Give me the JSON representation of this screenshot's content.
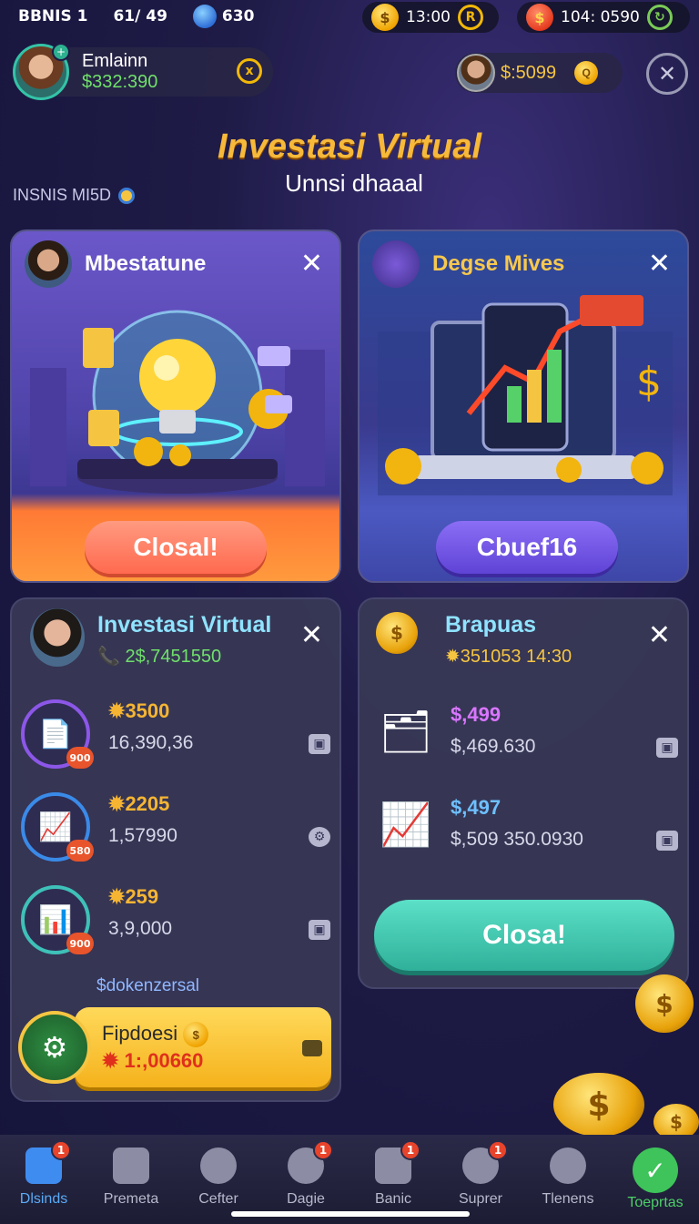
{
  "status": {
    "left_a": "BBNIS 1",
    "left_b": "61/ 49",
    "left_c": "630",
    "coins": "13:00",
    "gems": "104: 0590"
  },
  "profile": {
    "name": "Emlainn",
    "money": "$332:390"
  },
  "wallet": {
    "amount": "$:5099"
  },
  "title": "Investasi Virtual",
  "subtitle": "Unnsi dhaaal",
  "section_label": "INSNIS MI5D",
  "card_left": {
    "title": "Mbestatune",
    "button": "Closal!"
  },
  "card_right": {
    "title": "Degse Mives",
    "button": "Cbuef16"
  },
  "panel_left": {
    "title": "Investasi Virtual",
    "subtitle": "2$,7451550",
    "rows": [
      {
        "value": "3500",
        "sub": "16,390,36",
        "badge": "900"
      },
      {
        "value": "2205",
        "sub": "1,57990",
        "badge": "580"
      },
      {
        "value": "259",
        "sub": "3,9,000",
        "badge": "900"
      }
    ],
    "section": "$dokenzersal",
    "fund_title": "Fipdoesi",
    "fund_value": "1:,00660"
  },
  "panel_right": {
    "title": "Brapuas",
    "subtitle": "351053 14:30",
    "rows": [
      {
        "value": "$,499",
        "sub": "$,469.630"
      },
      {
        "value": "$,497",
        "sub": "$,509 350.0930"
      }
    ],
    "button": "Closa!"
  },
  "nav": [
    {
      "label": "Dlsinds",
      "badge": "1"
    },
    {
      "label": "Premeta",
      "badge": ""
    },
    {
      "label": "Cefter",
      "badge": ""
    },
    {
      "label": "Dagie",
      "badge": "1"
    },
    {
      "label": "Banic",
      "badge": "1"
    },
    {
      "label": "Suprer",
      "badge": "1"
    },
    {
      "label": "Tlenens",
      "badge": ""
    },
    {
      "label": "Toeprtas",
      "badge": ""
    }
  ]
}
